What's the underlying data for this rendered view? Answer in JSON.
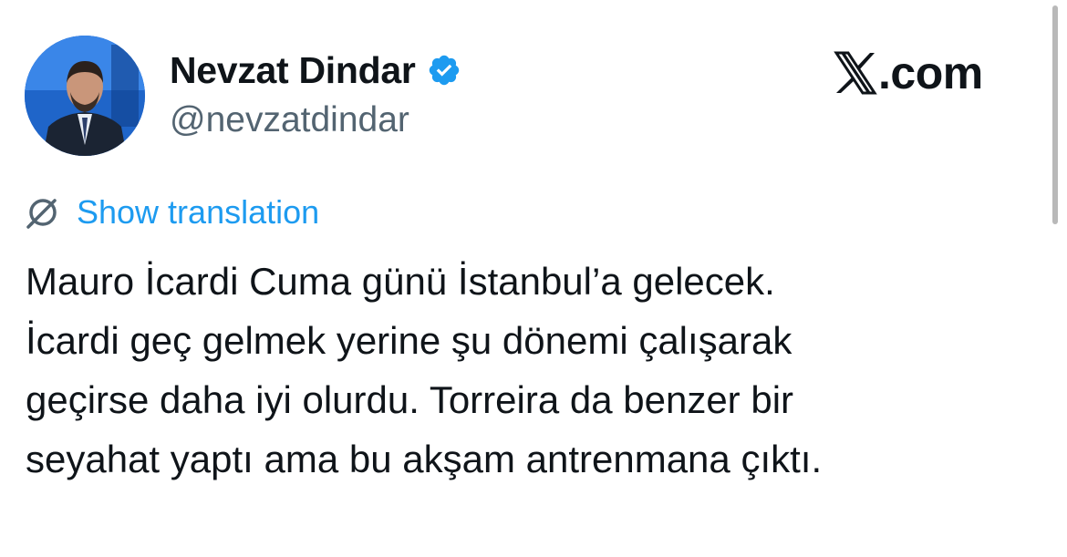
{
  "author": {
    "display_name": "Nevzat Dindar",
    "handle": "@nevzatdindar",
    "verified": true,
    "avatar_icon": "profile-photo"
  },
  "brand": {
    "text": ".com",
    "logo_icon": "x-logo-icon"
  },
  "translation": {
    "label": "Show translation",
    "icon": "globe-icon"
  },
  "tweet": {
    "lines": [
      "Mauro İcardi Cuma günü İstanbul’a gelecek.",
      "İcardi geç gelmek yerine şu dönemi çalışarak",
      "geçirse daha iyi olurdu. Torreira da benzer bir",
      "seyahat yaptı ama bu akşam antrenmana çıktı."
    ]
  },
  "colors": {
    "text": "#0f1419",
    "secondary": "#536471",
    "link": "#1d9bf0",
    "verified": "#1d9bf0",
    "background": "#ffffff"
  }
}
